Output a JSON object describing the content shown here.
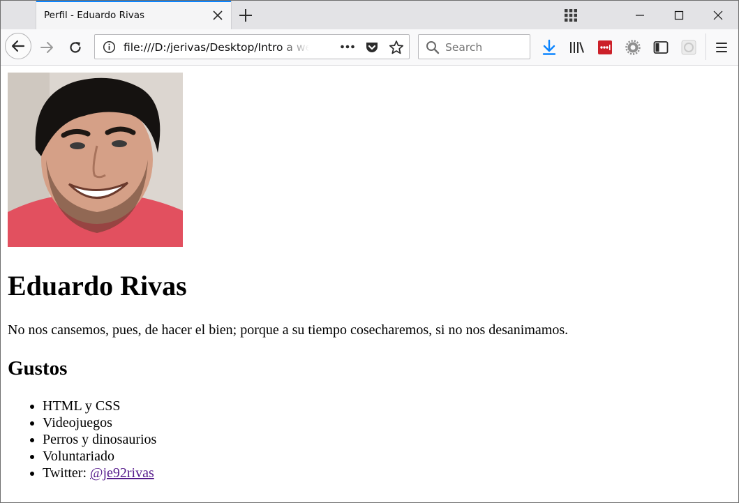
{
  "browser": {
    "tab_title": "Perfil - Eduardo Rivas",
    "url": "file:///D:/jerivas/Desktop/Intro a web",
    "search_placeholder": "Search",
    "accent_color": "#0a84ff",
    "icons": [
      "all-tabs-grid-icon",
      "minimize-icon",
      "maximize-icon",
      "close-window-icon",
      "back-icon",
      "forward-icon",
      "reload-icon",
      "info-icon",
      "page-actions-icon",
      "pocket-icon",
      "bookmark-star-icon",
      "search-icon",
      "download-icon",
      "library-icon",
      "lastpass-icon",
      "gear-extension-icon",
      "sidebar-icon",
      "extension-icon",
      "menu-icon"
    ]
  },
  "page": {
    "name": "Eduardo Rivas",
    "quote": "No nos cansemos, pues, de hacer el bien; porque a su tiempo cosecharemos, si no nos desanimamos.",
    "likes_heading": "Gustos",
    "likes": [
      "HTML y CSS",
      "Videojuegos",
      "Perros y dinosaurios",
      "Voluntariado"
    ],
    "twitter_label": "Twitter:",
    "twitter_handle": "@je92rivas",
    "link_color": "#551a8b"
  }
}
